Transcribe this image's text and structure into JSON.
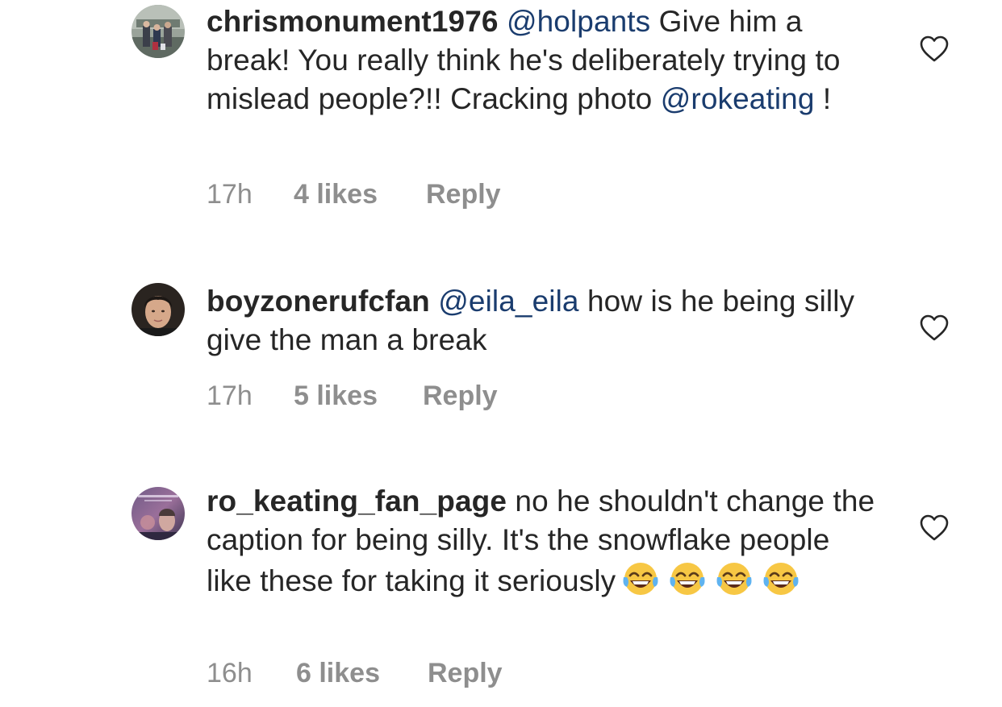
{
  "comments": [
    {
      "username": "chrismonument1976",
      "mention": "@holpants",
      "text_part1": " Give him a break! You really think he's deliberately trying to mislead people?!! Cracking photo ",
      "mention2": "@rokeating",
      "text_part2": " !",
      "time": "17h",
      "likes": "4 likes",
      "reply": "Reply",
      "avatar_icon": "family-photo-avatar",
      "like_icon": "heart-outline-icon"
    },
    {
      "username": "boyzonerufcfan",
      "mention": "@eila_eila",
      "text_part1": " how is he being silly give the man a break",
      "time": "17h",
      "likes": "5 likes",
      "reply": "Reply",
      "avatar_icon": "man-portrait-avatar",
      "like_icon": "heart-outline-icon"
    },
    {
      "username": "ro_keating_fan_page",
      "text_part1": " no he shouldn't change the caption for being silly. It's the snowflake people like these for taking it seriously",
      "emojis": [
        "😂",
        "😂",
        "😂",
        "😂"
      ],
      "time": "16h",
      "likes": "6 likes",
      "reply": "Reply",
      "avatar_icon": "album-cover-avatar",
      "like_icon": "heart-outline-icon"
    }
  ],
  "colors": {
    "text": "#262626",
    "mention": "#1a3c6e",
    "meta": "#8e8e8e",
    "background": "#ffffff"
  }
}
